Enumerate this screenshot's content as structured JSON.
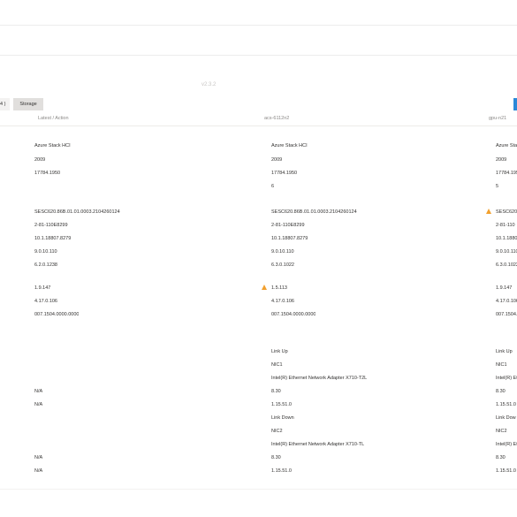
{
  "version": "v2.3.2",
  "tabs": [
    {
      "label": "4 )"
    },
    {
      "label": "Storage"
    }
  ],
  "columns": {
    "latest": "Latest / Action",
    "node1": "acs-6112n2",
    "node2": "gpu-n21"
  },
  "latest": {
    "os": "Azure Stack HCI",
    "os_version": "2009",
    "os_build": "17784.1950",
    "bios": "SESC620.86B.01.01.0003.2104260124",
    "bmc": "2-81-110E8299",
    "driver1": "10.1.18807.8279",
    "driver2": "9.0.10.110",
    "driver3": "6.2.0.1238",
    "fw1": "1.9.147",
    "fw2": "4.17.0.106",
    "fw3": "007.1504.0000.0000",
    "nic1_driver": "N/A",
    "nic1_fw": "N/A",
    "nic2_driver": "N/A",
    "nic2_fw": "N/A"
  },
  "node1": {
    "os": "Azure Stack HCI",
    "os_version": "2009",
    "os_build": "17784.1950",
    "count": "6",
    "bios": "SESC620.86B.01.01.0003.2104260124",
    "bmc": "2-81-110E8299",
    "driver1": "10.1.18807.8279",
    "driver2": "9.0.10.110",
    "driver3": "6.3.0.1022",
    "fw1": "1.5.113",
    "fw2": "4.17.0.106",
    "fw3": "007.1504.0000.0000",
    "nic1_status": "Link Up",
    "nic1_name": "NIC1",
    "nic1_model": "Intel(R) Ethernet Network Adapter X710-T2L",
    "nic1_driver": "8.30",
    "nic1_fw": "1.15.51.0",
    "nic2_status": "Link Down",
    "nic2_name": "NIC2",
    "nic2_model": "Intel(R) Ethernet Network Adapter X710-TL",
    "nic2_driver": "8.30",
    "nic2_fw": "1.15.51.0"
  },
  "node2": {
    "os": "Azure Sta",
    "os_version": "2009",
    "os_build": "17784.195",
    "count": "5",
    "bios": "SESC620.",
    "bmc": "2-81-110",
    "driver1": "10.1.1880",
    "driver2": "9.0.10.110",
    "driver3": "6.3.0.1022",
    "fw1": "1.9.147",
    "fw2": "4.17.0.106",
    "fw3": "007.1504.",
    "nic1_status": "Link Up",
    "nic1_name": "NIC1",
    "nic1_model": "Intel(R) Et",
    "nic1_driver": "8.30",
    "nic1_fw": "1.15.51.0",
    "nic2_status": "Link Dow",
    "nic2_name": "NIC2",
    "nic2_model": "Intel(R) Et",
    "nic2_driver": "8.30",
    "nic2_fw": "1.15.51.0"
  },
  "colors": {
    "warning": "#f2a02e",
    "primary": "#2b88d8"
  }
}
